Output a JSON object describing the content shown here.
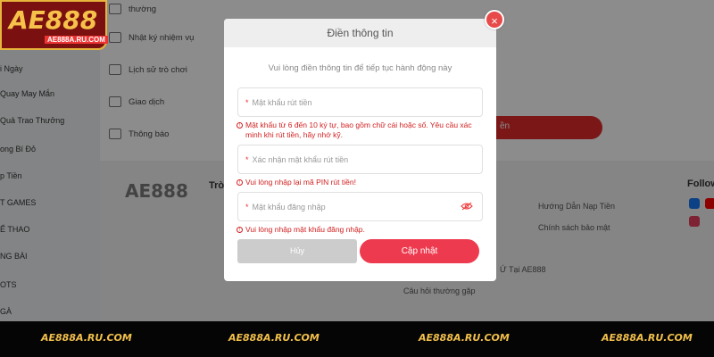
{
  "logo": {
    "text": "AE888",
    "domain": "AE888A.RU.COM"
  },
  "left_nav": [
    "i Ngày",
    "Quay May Mắn",
    "Quả Trao Thưởng",
    "ong Bí Đỏ",
    "p Tiền",
    "T GAMES",
    "Ể THAO",
    "NG BÀI",
    "OTS",
    "GÀ"
  ],
  "account_menu": {
    "items": [
      {
        "label": "thường",
        "icon": "user-icon"
      },
      {
        "label": "Nhật ký nhiệm vụ",
        "icon": "task-icon"
      },
      {
        "label": "Lịch sử trò chơi",
        "icon": "history-icon"
      },
      {
        "label": "Giao dịch",
        "icon": "transaction-icon"
      },
      {
        "label": "Thông báo",
        "icon": "mail-icon"
      }
    ]
  },
  "page": {
    "button_fragment": "ền"
  },
  "footer": {
    "col_heading": "Trò",
    "follow": "Follow",
    "links": [
      "Hướng Dẫn Nạp Tiền",
      "Chính sách bảo mật",
      "Ứ Tại AE888",
      "Câu hỏi thường gặp"
    ]
  },
  "modal": {
    "title": "Điền thông tin",
    "subtitle": "Vui lòng điền thông tin để tiếp tục hành động này",
    "fields": {
      "withdraw_password": {
        "required_mark": "*",
        "placeholder": "Mật khẩu rút tiền"
      },
      "confirm_withdraw_password": {
        "required_mark": "*",
        "placeholder": "Xác nhận mật khẩu rút tiền"
      },
      "login_password": {
        "required_mark": "*",
        "placeholder": "Mật khẩu đăng nhập"
      }
    },
    "errors": {
      "withdraw_password": "Mật khẩu từ 6 đến 10 ký tự, bao gồm chữ cái hoặc số. Yêu cầu xác minh khi rút tiền, hãy nhớ kỹ.",
      "confirm_withdraw_password": "Vui lòng nhập lại mã PIN rút tiền!",
      "login_password": "Vui lòng nhập mật khẩu đăng nhập."
    },
    "cancel_label": "Hủy",
    "update_label": "Cập nhật",
    "close_label": "×"
  },
  "banner": [
    "AE888A.RU.COM",
    "AE888A.RU.COM",
    "AE888A.RU.COM",
    "AE888A.RU.COM"
  ],
  "colors": {
    "accent": "#ee3a4e",
    "error": "#d21f1f",
    "banner_text": "#f2c04b"
  }
}
